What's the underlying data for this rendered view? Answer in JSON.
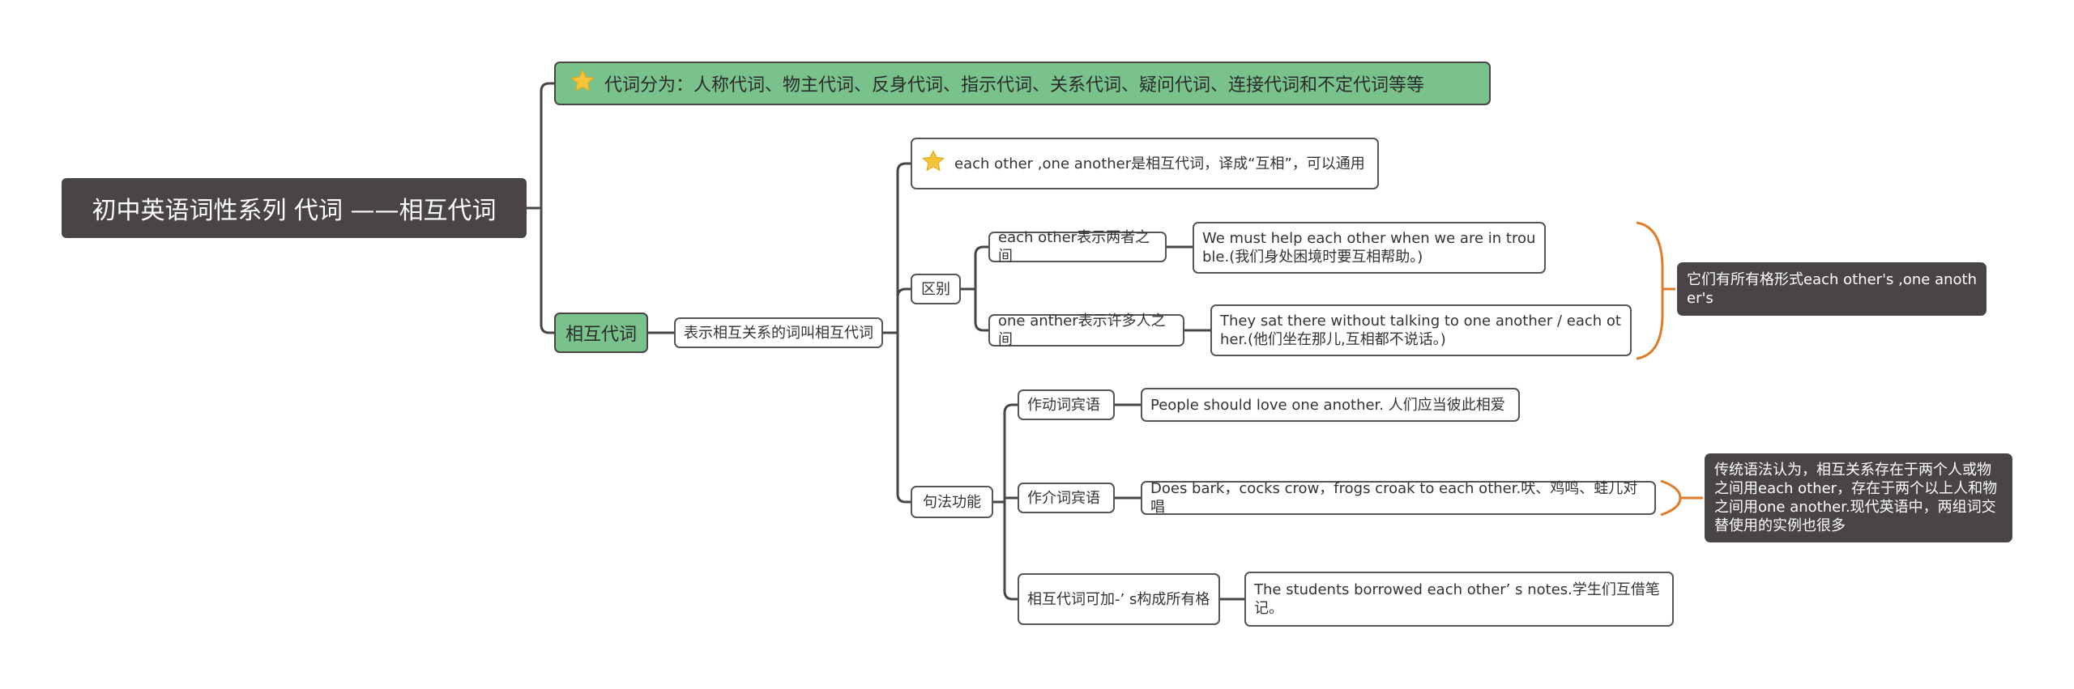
{
  "root": {
    "label": "初中英语词性系列 代词 ——相互代词"
  },
  "topic1": {
    "label": "代词分为：人称代词、物主代词、反身代词、指示代词、关系代词、疑问代词、连接代词和不定代词等等",
    "icon": "star-icon"
  },
  "topic2": {
    "label": "相互代词"
  },
  "def": {
    "label": "表示相互关系的词叫相互代词"
  },
  "note1": {
    "label": "each other ,one another是相互代词，译成“互相”，可以通用",
    "icon": "star-icon"
  },
  "diff": {
    "label": "区别",
    "two": {
      "label": "each other表示两者之间",
      "example": "We must help each other when we are in trouble.(我们身处困境时要互相帮助。)"
    },
    "many": {
      "label": "one anther表示许多人之间",
      "example": "They sat there without talking to one another / each other.(他们坐在那儿,互相都不说话。)"
    },
    "summary": "它们有所有格形式each other's ,one another's"
  },
  "syntax": {
    "label": "句法功能",
    "verb_obj": {
      "label": "作动词宾语",
      "example": "People should love one another. 人们应当彼此相爱"
    },
    "prep_obj": {
      "label": "作介词宾语",
      "example": "Does bark，cocks crow，frogs croak to each other.吠、鸡鸣、蛙儿对唱"
    },
    "possessive": {
      "label": "相互代词可加-’ s构成所有格",
      "example": "The students borrowed each other’ s notes.学生们互借笔记。"
    },
    "summary": "传统语法认为，相互关系存在于两个人或物之间用each other，存在于两个以上人和物之间用one another.现代英语中，两组词交替使用的实例也很多"
  },
  "colors": {
    "dark": "#4a4545",
    "green": "#7ac28c",
    "bracket": "#e07b27",
    "star": "#f6c43a"
  }
}
